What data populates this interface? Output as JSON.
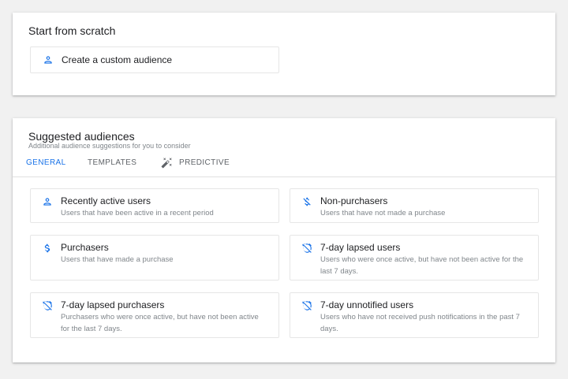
{
  "colors": {
    "accent": "#1a73e8",
    "icon_blue": "#1a73e8",
    "text_secondary": "#80868b",
    "background": "#f1f1f1"
  },
  "scratch": {
    "title": "Start from scratch",
    "custom_tile": {
      "icon": "person-icon",
      "title": "Create a custom audience"
    }
  },
  "suggested": {
    "title": "Suggested audiences",
    "subtitle": "Additional audience suggestions for you to consider",
    "tabs": [
      {
        "label": "GENERAL",
        "active": true
      },
      {
        "label": "TEMPLATES",
        "active": false
      },
      {
        "label": "PREDICTIVE",
        "active": false,
        "icon": "magic-wand-icon"
      }
    ],
    "tiles": [
      {
        "icon": "person-icon",
        "title": "Recently active users",
        "description": "Users that have been active in a recent period"
      },
      {
        "icon": "no-dollar-icon",
        "title": "Non-purchasers",
        "description": "Users that have not made a purchase"
      },
      {
        "icon": "dollar-icon",
        "title": "Purchasers",
        "description": "Users that have made a purchase"
      },
      {
        "icon": "alarm-off-icon",
        "title": "7-day lapsed users",
        "description": "Users who were once active, but have not been active for the last 7 days."
      },
      {
        "icon": "alarm-off-icon",
        "title": "7-day lapsed purchasers",
        "description": "Purchasers who were once active, but have not been active for the last 7 days."
      },
      {
        "icon": "alarm-off-icon",
        "title": "7-day unnotified users",
        "description": "Users who have not received push notifications in the past 7 days."
      }
    ]
  }
}
